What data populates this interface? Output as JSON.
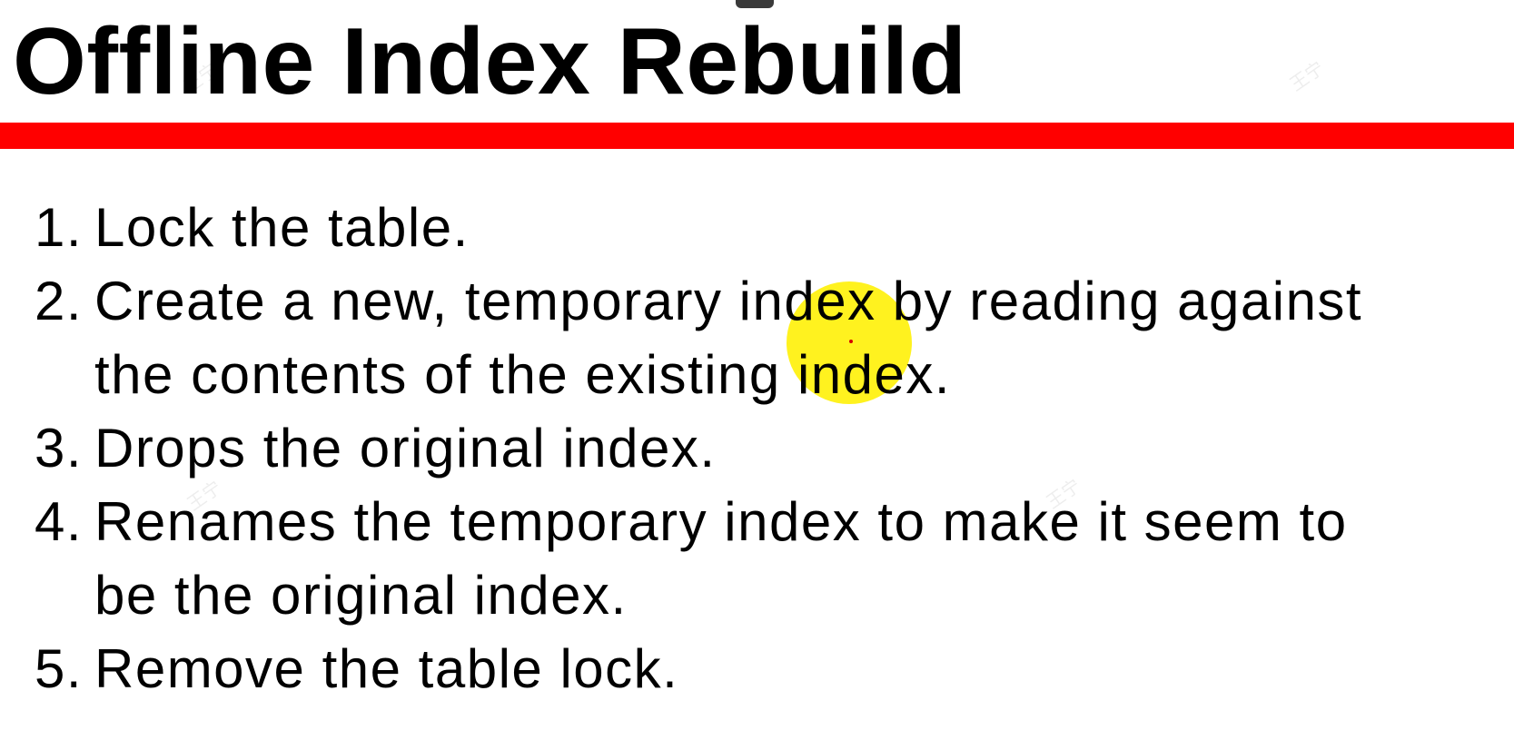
{
  "slide": {
    "title": "Offline Index Rebuild",
    "steps": [
      {
        "number": "1.",
        "lines": [
          "Lock the table."
        ]
      },
      {
        "number": "2.",
        "lines": [
          "Create a new, temporary index by reading against",
          "the contents of the existing index."
        ]
      },
      {
        "number": "3.",
        "lines": [
          "Drops the original index."
        ]
      },
      {
        "number": "4.",
        "lines": [
          "Renames the temporary index to make it seem to",
          "be the original index."
        ]
      },
      {
        "number": "5.",
        "lines": [
          "Remove the table lock."
        ]
      }
    ],
    "watermark_text": "王宁"
  },
  "colors": {
    "accent_rule": "#ff0000",
    "cursor_highlight": "#fff000",
    "text": "#000000"
  },
  "icons": {
    "cursor": "cursor-highlight-icon"
  }
}
